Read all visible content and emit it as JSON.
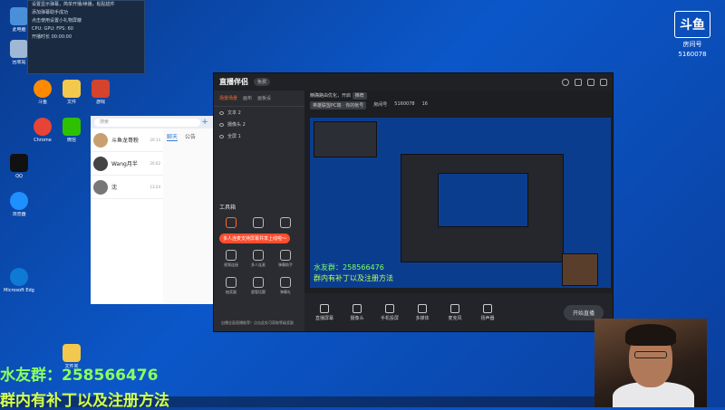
{
  "desktop": {
    "icons": [
      {
        "label": "此电脑",
        "color": "#4a90d9"
      },
      {
        "label": "回收站",
        "color": "#9fb8d6"
      },
      {
        "label": "斗鱼",
        "color": "#ff8a00"
      },
      {
        "label": "文件",
        "color": "#f2c94c"
      },
      {
        "label": "游戏",
        "color": "#d4432c"
      },
      {
        "label": "Chrome",
        "color": "#e94335"
      },
      {
        "label": "微信",
        "color": "#2dc100"
      },
      {
        "label": "QQ",
        "color": "#111111"
      },
      {
        "label": "浏览器",
        "color": "#1e90ff"
      },
      {
        "label": "Microsoft Edge",
        "color": "#0e7ad6"
      },
      {
        "label": "文件夹",
        "color": "#f2c94c"
      }
    ]
  },
  "popup_lines": [
    "设置显示弹幕，简单开播/续播，粘贴插件",
    "添加弹幕助手成功",
    "点击使用设置小礼物屏蔽",
    "CPU: GPU: FPS: 60",
    "开播时长 00:00:00"
  ],
  "brand": {
    "logo": "斗鱼",
    "sub": "房间号",
    "room": "5160078"
  },
  "chat": {
    "search_placeholder": "搜索",
    "items": [
      {
        "name": "斗鱼龙哥粉",
        "time": "20:14"
      },
      {
        "name": "Wang月半",
        "time": "20:02"
      },
      {
        "name": "沈",
        "time": "13:24"
      }
    ],
    "tabs": [
      "聊天",
      "公告"
    ]
  },
  "app": {
    "title": "直播伴侣",
    "version": "免费",
    "left_tabs": [
      "场景场景",
      "画布",
      "画板设"
    ],
    "sources": [
      "文本 2",
      "摄像头 2",
      "全屏 1"
    ],
    "tools_title": "工具箱",
    "tools": [
      {
        "label": "视频连接",
        "active": true
      },
      {
        "label": "多人连麦",
        "active": false
      },
      {
        "label": "弹幕助手",
        "active": false
      },
      {
        "label": "抽奖器",
        "active": false
      },
      {
        "label": "超管话题",
        "active": false
      },
      {
        "label": "弹幕礼",
        "active": false
      }
    ],
    "tooltip": "多人连麦支持屏幕共享上线啦～",
    "bottom_tip": "自播全面直播推荐！点击此处可获取等级奖励",
    "header_line1": "精确路由优化，开启",
    "header_pill": "推荐",
    "header_category": "英雄联盟PC端 · 你的帐号",
    "header_room_label": "房间号",
    "header_room": "5160078",
    "header_viewers": "16",
    "preview_text1": "水友群：258566476",
    "preview_text2": "群内有补丁以及注册方法",
    "controls": [
      "直播屏幕",
      "摄像头",
      "手机投屏",
      "多媒体",
      "麦克风",
      "扬声器"
    ],
    "golive": "开始直播"
  },
  "overlay": {
    "line1": "水友群：258566476",
    "line2": "群内有补丁以及注册方法"
  }
}
